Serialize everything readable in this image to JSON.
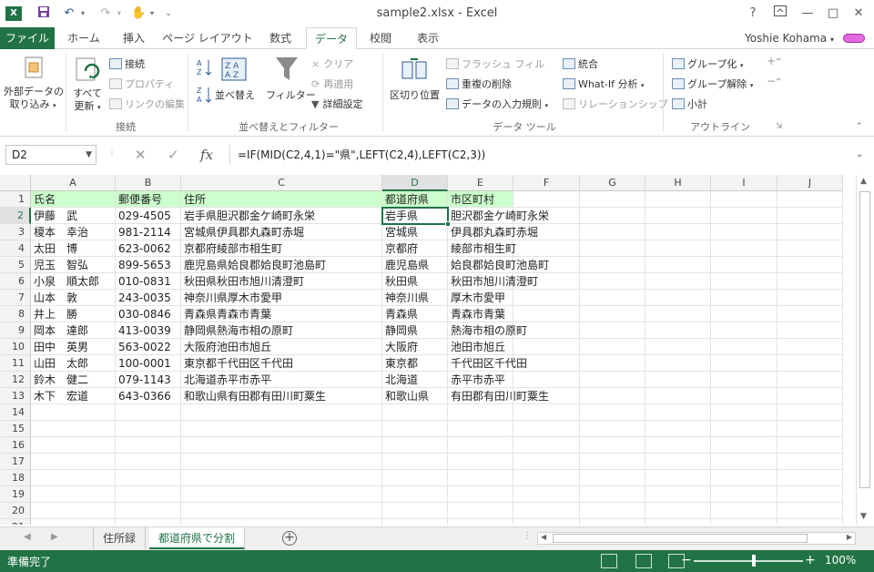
{
  "app": {
    "window_title": "sample2.xlsx - Excel",
    "logo_text": "X",
    "help": "?",
    "user_name": "Yoshie Kohama"
  },
  "tabs": [
    {
      "label": "ファイル",
      "active": false
    },
    {
      "label": "ホーム",
      "active": false
    },
    {
      "label": "挿入",
      "active": false
    },
    {
      "label": "ページ レイアウト",
      "active": false
    },
    {
      "label": "数式",
      "active": false
    },
    {
      "label": "データ",
      "active": true
    },
    {
      "label": "校閲",
      "active": false
    },
    {
      "label": "表示",
      "active": false
    }
  ],
  "ribbon": {
    "external_data": {
      "label_1": "外部データの",
      "label_2": "取り込み"
    },
    "refresh_all": {
      "label_1": "すべて",
      "label_2": "更新"
    },
    "connections": "接続",
    "properties": "プロパティ",
    "edit_links": "リンクの編集",
    "group_connections": "接続",
    "sort": "並べ替え",
    "filter": "フィルター",
    "clear": "クリア",
    "reapply": "再適用",
    "advanced": "詳細設定",
    "group_sort_filter": "並べ替えとフィルター",
    "text_to_columns": "区切り位置",
    "flash_fill": "フラッシュ フィル",
    "remove_duplicates": "重複の削除",
    "data_validation": "データの入力規則",
    "consolidate": "統合",
    "what_if": "What-If 分析",
    "relationships": "リレーションシップ",
    "group_data_tools": "データ ツール",
    "group": "グループ化",
    "ungroup": "グループ解除",
    "subtotal": "小計",
    "group_outline": "アウトライン"
  },
  "formula_bar": {
    "name_box": "D2",
    "fx": "fx",
    "formula": "=IF(MID(C2,4,1)=\"県\",LEFT(C2,4),LEFT(C2,3))"
  },
  "grid": {
    "columns": [
      "A",
      "B",
      "C",
      "D",
      "E",
      "F",
      "G",
      "H",
      "I",
      "J"
    ],
    "selected_column": "D",
    "selected_row": 2,
    "row_numbers": [
      1,
      2,
      3,
      4,
      5,
      6,
      7,
      8,
      9,
      10,
      11,
      12,
      13,
      14,
      15,
      16,
      17,
      18,
      19,
      20,
      21
    ],
    "rows": [
      [
        "氏名",
        "郵便番号",
        "住所",
        "都道府県",
        "市区町村"
      ],
      [
        "伊藤　武",
        "029-4505",
        "岩手県胆沢郡金ケ崎町永栄",
        "岩手県",
        "胆沢郡金ケ崎町永栄"
      ],
      [
        "榎本　幸治",
        "981-2114",
        "宮城県伊具郡丸森町赤堀",
        "宮城県",
        "伊具郡丸森町赤堀"
      ],
      [
        "太田　博",
        "623-0062",
        "京都府綾部市相生町",
        "京都府",
        "綾部市相生町"
      ],
      [
        "児玉　智弘",
        "899-5653",
        "鹿児島県姶良郡姶良町池島町",
        "鹿児島県",
        "姶良郡姶良町池島町"
      ],
      [
        "小泉　順太郎",
        "010-0831",
        "秋田県秋田市旭川清澄町",
        "秋田県",
        "秋田市旭川清澄町"
      ],
      [
        "山本　敦",
        "243-0035",
        "神奈川県厚木市愛甲",
        "神奈川県",
        "厚木市愛甲"
      ],
      [
        "井上　勝",
        "030-0846",
        "青森県青森市青葉",
        "青森県",
        "青森市青葉"
      ],
      [
        "岡本　達郎",
        "413-0039",
        "静岡県熱海市相の原町",
        "静岡県",
        "熱海市相の原町"
      ],
      [
        "田中　英男",
        "563-0022",
        "大阪府池田市旭丘",
        "大阪府",
        "池田市旭丘"
      ],
      [
        "山田　太郎",
        "100-0001",
        "東京都千代田区千代田",
        "東京都",
        "千代田区千代田"
      ],
      [
        "鈴木　健二",
        "079-1143",
        "北海道赤平市赤平",
        "北海道",
        "赤平市赤平"
      ],
      [
        "木下　宏道",
        "643-0366",
        "和歌山県有田郡有田川町粟生",
        "和歌山県",
        "有田郡有田川町粟生"
      ]
    ]
  },
  "sheets": [
    {
      "label": "住所録",
      "active": false
    },
    {
      "label": "都道府県で分割",
      "active": true
    }
  ],
  "status": {
    "ready": "準備完了",
    "zoom": "100%"
  },
  "colors": {
    "accent": "#217346",
    "header_fill": "#ccffcc"
  }
}
